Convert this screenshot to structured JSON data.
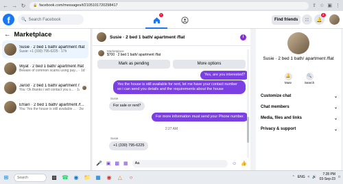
{
  "browser": {
    "url": "facebook.com/messages/t/2105101720298417"
  },
  "header": {
    "search_placeholder": "Search Facebook",
    "find_friends": "Find friends",
    "messenger_badge": "",
    "notifications_badge": "4"
  },
  "marketplace": {
    "title": "Marketplace",
    "conversations": [
      {
        "name": "Susie · 2 bed 1 bath/ apartment /flat",
        "sub": "Susie: +1 (330) 795-6225 · 17h"
      },
      {
        "name": "Wyat · 2 bed 1 bath/ apartment /flat",
        "sub": "Beware of common scams using pay... · 1d"
      },
      {
        "name": "Jarod · 2 bed 1 bath/ apartment /flat",
        "sub": "You: Ok thanks i will contact you s... · 1w"
      },
      {
        "name": "Efrain · 2 bed 1 bath/ apartment /f...",
        "sub": "You: Yes the house is still available ... · 2w"
      }
    ]
  },
  "chat": {
    "title": "Susie · 2 bed 1 bath/ apartment /flat",
    "listing_label": "Marketplace",
    "listing_price": "$700 · 2 bed 1 bath/ apartment /flat",
    "mark_pending": "Mark as pending",
    "more_options": "More options",
    "messages": [
      {
        "text": "Yes, are you interested?"
      },
      {
        "text": "Yes the house is still available for rent, let me have your contact number so i can send you details and the requirements about the house"
      },
      {
        "sender": "Susie",
        "text": "For sale or rent?"
      },
      {
        "text": "For more information must send your Phone number."
      },
      {
        "timestamp": "2:27 AM"
      },
      {
        "sender": "Susie",
        "text": "+1 (330) 795-6225"
      }
    ],
    "composer_value": "Aa"
  },
  "details": {
    "name": "Susie · 2 bed 1 bath/ apartment /flat",
    "mute": "Mute",
    "search": "Search",
    "sections": [
      "Customize chat",
      "Chat members",
      "Media, files and links",
      "Privacy & support"
    ]
  },
  "taskbar": {
    "search": "Search",
    "lang": "ENG",
    "time": "7:28 PM",
    "date": "03-Sep-23"
  }
}
